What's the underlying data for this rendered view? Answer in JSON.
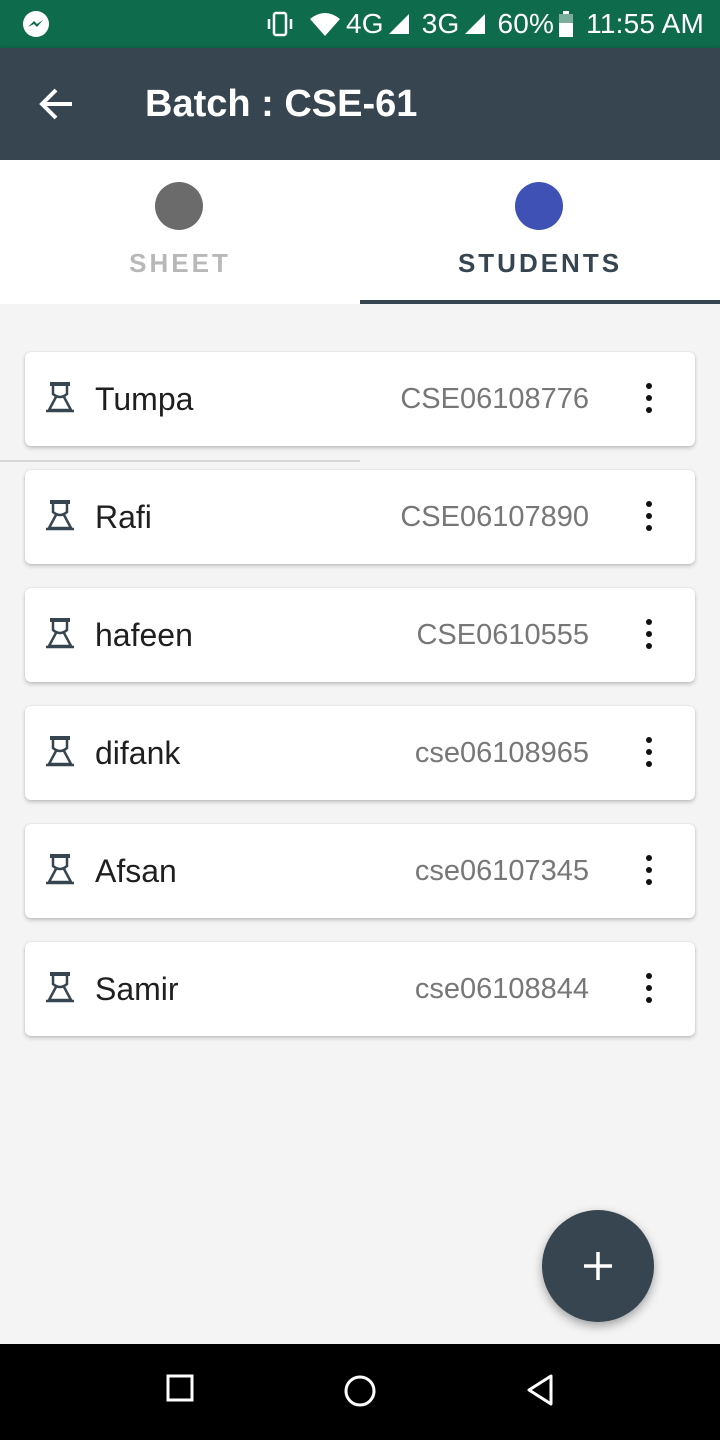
{
  "status_bar": {
    "icons": [
      "messenger-icon",
      "vibrate-icon",
      "wifi-icon",
      "signal-icon",
      "signal-icon",
      "battery-icon"
    ],
    "network_1": "4G",
    "network_2": "3G",
    "battery": "60%",
    "time": "11:55 AM"
  },
  "app_bar": {
    "title": "Batch : CSE-61",
    "back_icon": "arrow-back-icon"
  },
  "tabs": [
    {
      "label": "SHEET",
      "selected": false,
      "dot_color": "#6b6b6b"
    },
    {
      "label": "STUDENTS",
      "selected": true,
      "dot_color": "#3f51b5"
    }
  ],
  "students": [
    {
      "name": "Tumpa",
      "id": "CSE06108776"
    },
    {
      "name": "Rafi",
      "id": "CSE06107890"
    },
    {
      "name": "hafeen",
      "id": "CSE0610555"
    },
    {
      "name": "difank",
      "id": "cse06108965"
    },
    {
      "name": "Afsan",
      "id": "cse06107345"
    },
    {
      "name": "Samir",
      "id": "cse06108844"
    }
  ],
  "fab": {
    "icon": "plus-icon"
  },
  "nav_bar": {
    "icons": [
      "recent-apps-icon",
      "home-icon",
      "back-triangle-icon"
    ]
  },
  "colors": {
    "status_bar": "#0e6b4b",
    "app_bar": "#36454f",
    "accent_dot": "#3f51b5"
  }
}
